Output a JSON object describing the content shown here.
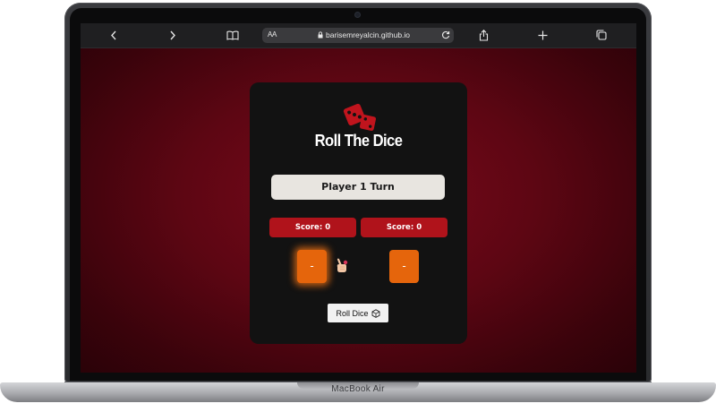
{
  "browser": {
    "text_size_label": "AA",
    "url": "barisemreyalcin.github.io"
  },
  "device": {
    "label": "MacBook Air"
  },
  "game": {
    "title": "Roll The Dice",
    "turn_text": "Player 1 Turn",
    "players": [
      {
        "score_label": "Score:",
        "score": "0",
        "die_value": "-",
        "active": true
      },
      {
        "score_label": "Score:",
        "score": "0",
        "die_value": "-",
        "active": false
      }
    ],
    "roll_button_label": "Roll Dice",
    "icons": {
      "logo": "dice-logo-icon",
      "turn_indicator": "pointing-hand-icon",
      "roll": "die-icon"
    },
    "colors": {
      "background": "#5d0613",
      "card": "#121212",
      "score_bar": "#b0131b",
      "die": "#e5650c",
      "turn_box": "#e8e5e0"
    }
  }
}
